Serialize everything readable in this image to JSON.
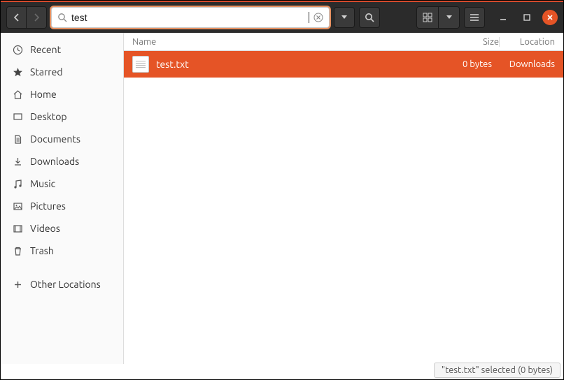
{
  "search": {
    "query": "test"
  },
  "columns": {
    "name": "Name",
    "size": "Size",
    "location": "Location"
  },
  "sidebar": {
    "items": [
      {
        "label": "Recent"
      },
      {
        "label": "Starred"
      },
      {
        "label": "Home"
      },
      {
        "label": "Desktop"
      },
      {
        "label": "Documents"
      },
      {
        "label": "Downloads"
      },
      {
        "label": "Music"
      },
      {
        "label": "Pictures"
      },
      {
        "label": "Videos"
      },
      {
        "label": "Trash"
      }
    ],
    "other": "Other Locations"
  },
  "files": [
    {
      "name": "test.txt",
      "size": "0 bytes",
      "location": "Downloads"
    }
  ],
  "status": "\"test.txt\" selected  (0 bytes)"
}
